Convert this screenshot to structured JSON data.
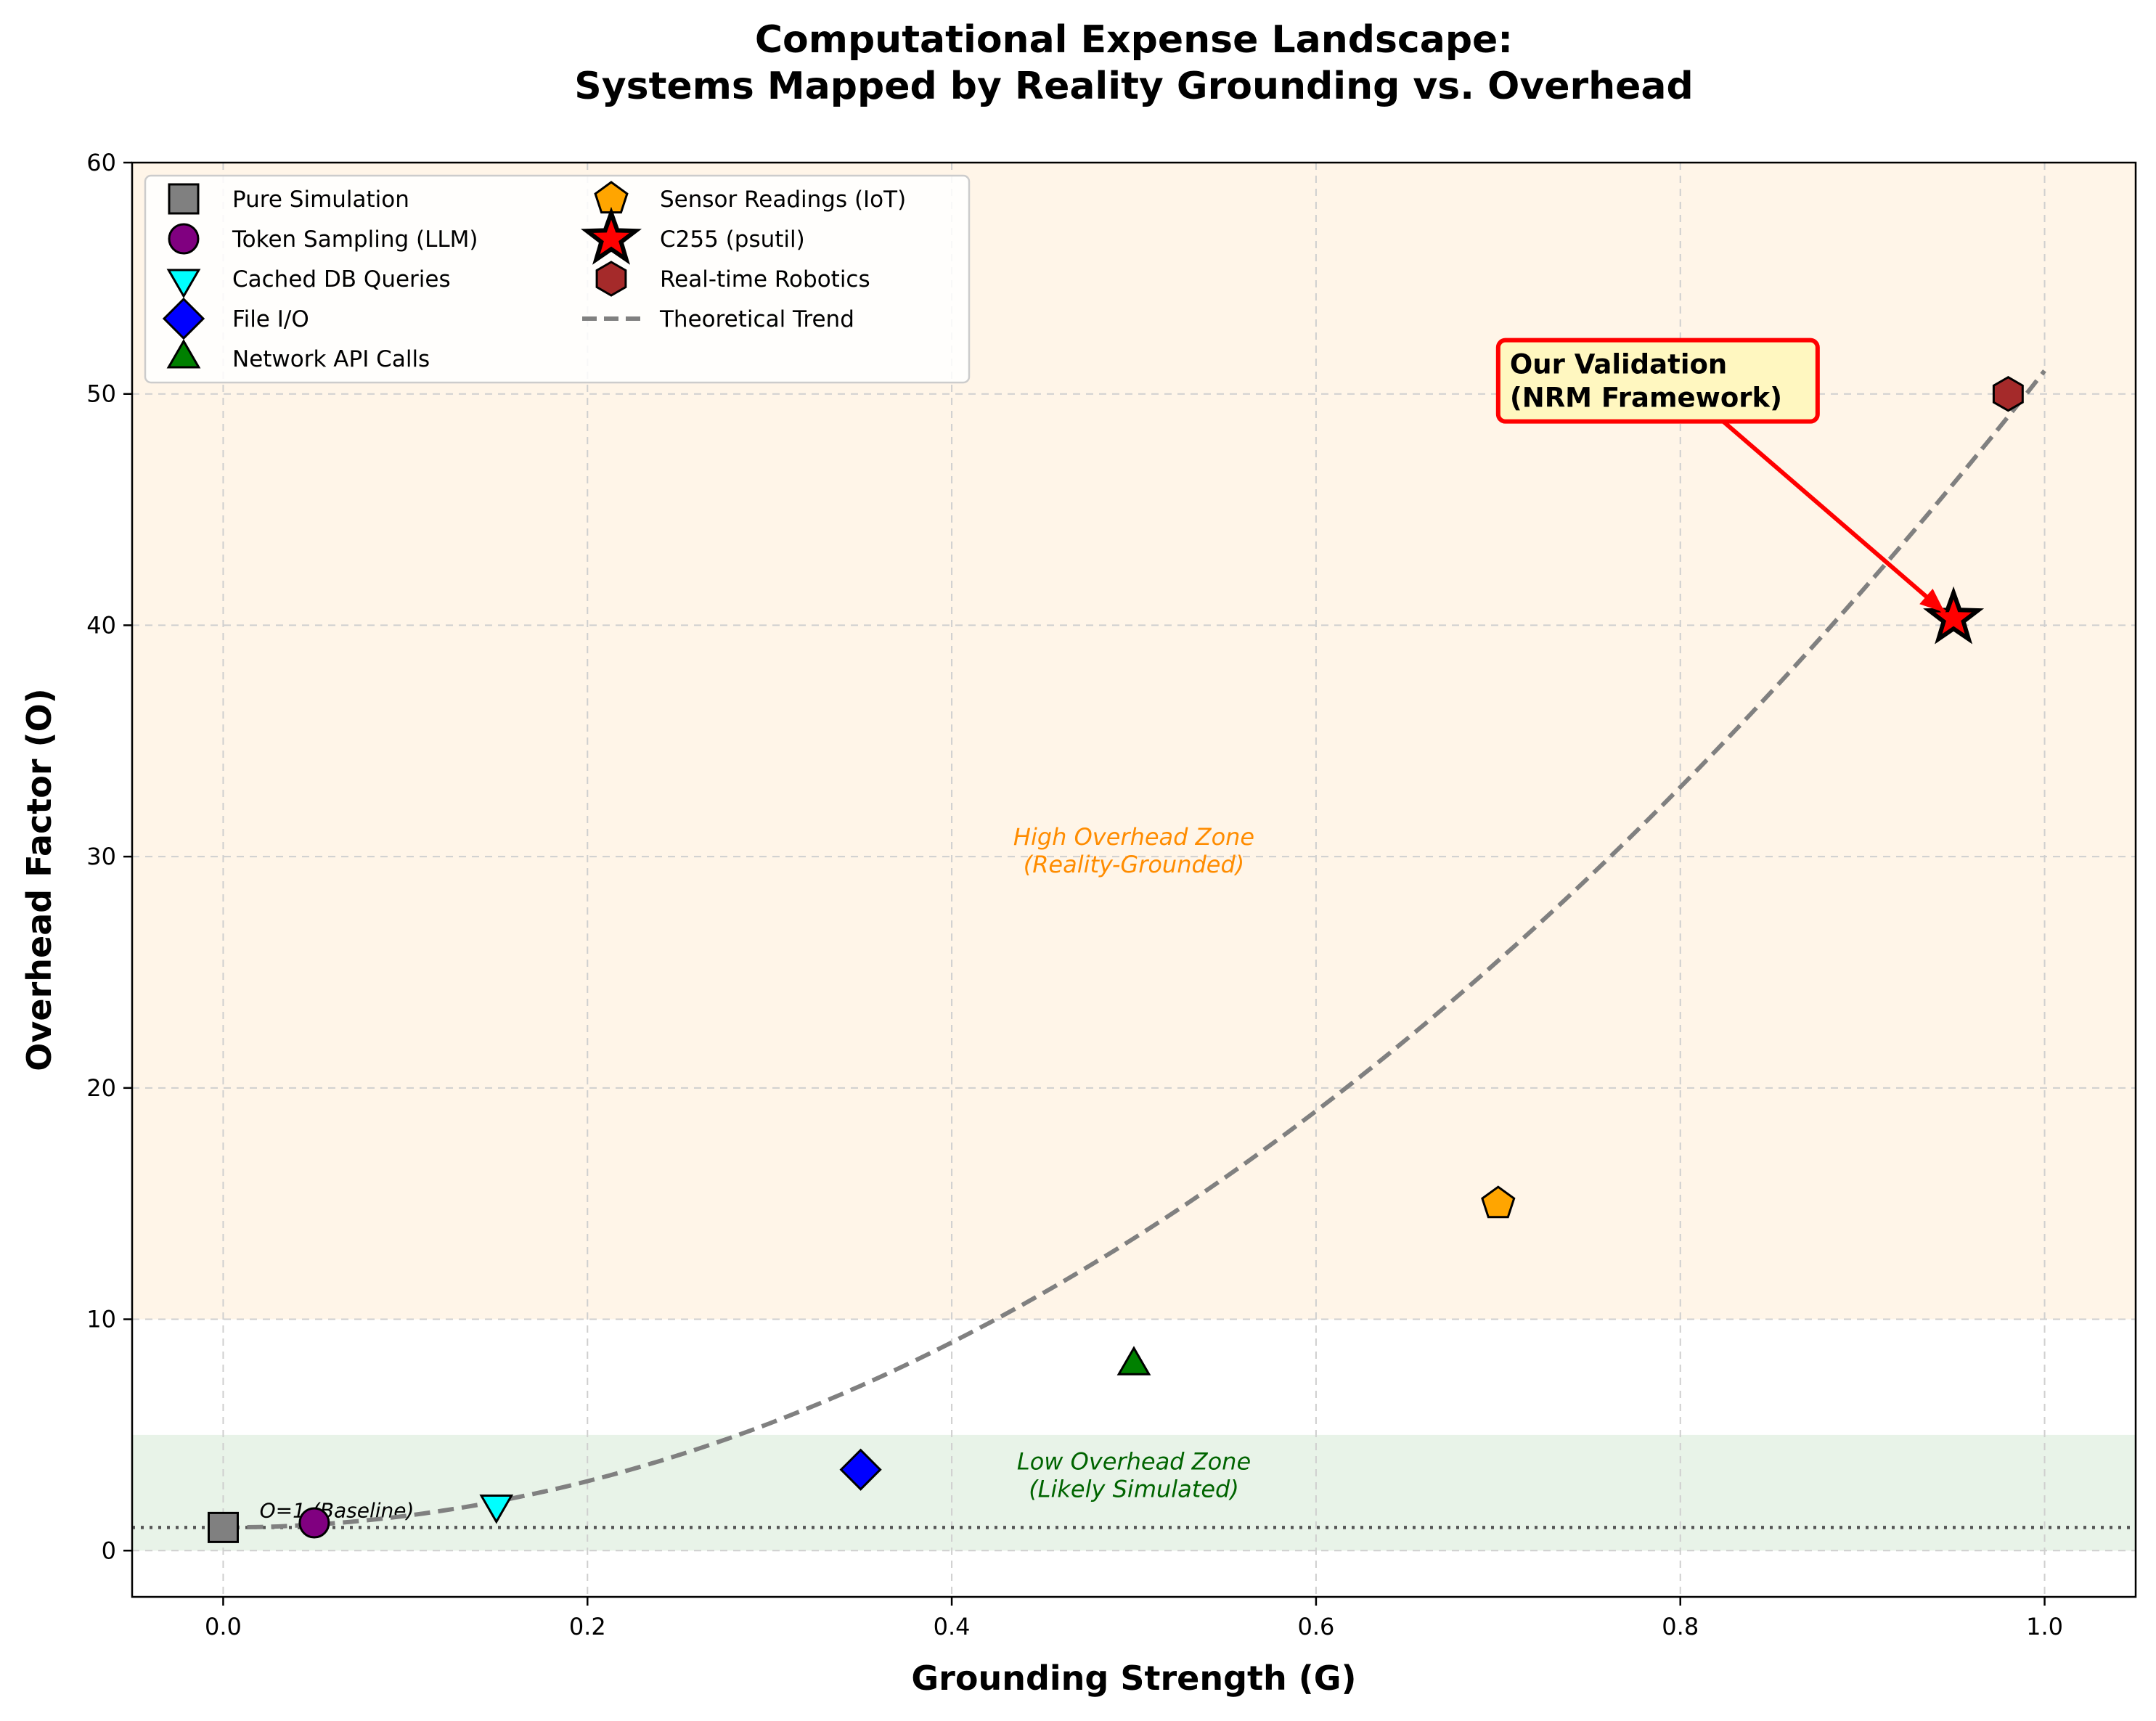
{
  "chart_data": {
    "type": "scatter",
    "title": [
      "Computational Expense Landscape:",
      "Systems Mapped by Reality Grounding vs. Overhead"
    ],
    "xlabel": "Grounding Strength (G)",
    "ylabel": "Overhead Factor (O)",
    "xlim": [
      -0.05,
      1.05
    ],
    "ylim": [
      -2,
      60
    ],
    "xticks": [
      "0.0",
      "0.2",
      "0.4",
      "0.6",
      "0.8",
      "1.0"
    ],
    "yticks": [
      "0",
      "10",
      "20",
      "30",
      "40",
      "50",
      "60"
    ],
    "grid": true,
    "legend_placement": "top-left",
    "series": [
      {
        "name": "Pure Simulation",
        "x": 0.0,
        "y": 1.0,
        "marker": "square",
        "color": "#808080"
      },
      {
        "name": "Token Sampling (LLM)",
        "x": 0.05,
        "y": 1.2,
        "marker": "circle",
        "color": "#800080"
      },
      {
        "name": "Cached DB Queries",
        "x": 0.15,
        "y": 2.0,
        "marker": "triangle-down",
        "color": "#00ffff"
      },
      {
        "name": "File I/O",
        "x": 0.35,
        "y": 3.5,
        "marker": "diamond",
        "color": "#0000ff"
      },
      {
        "name": "Network API Calls",
        "x": 0.5,
        "y": 8.0,
        "marker": "triangle-up",
        "color": "#008000"
      },
      {
        "name": "Sensor Readings (IoT)",
        "x": 0.7,
        "y": 15.0,
        "marker": "pentagon",
        "color": "#ffa500"
      },
      {
        "name": "C255 (psutil)",
        "x": 0.95,
        "y": 40.3,
        "marker": "star",
        "color": "#ff0000"
      },
      {
        "name": "Real-time Robotics",
        "x": 0.98,
        "y": 50.0,
        "marker": "hexagon",
        "color": "#a52a2a"
      }
    ],
    "trend": {
      "name": "Theoretical Trend",
      "formula": "O = 1 + 50*G^2",
      "style": "dashed",
      "color": "#808080"
    },
    "baseline": {
      "value": 1,
      "label": "O=1 (Baseline)",
      "style": "dotted"
    },
    "zones": [
      {
        "label": [
          "High Overhead Zone",
          "(Reality-Grounded)"
        ],
        "ymin": 10,
        "ymax": 60,
        "color": "#fff5e8",
        "text_color": "#ff8c00",
        "label_x": 0.5,
        "label_y": 30.5
      },
      {
        "label": [
          "Low Overhead Zone",
          "(Likely Simulated)"
        ],
        "ymin": 0,
        "ymax": 5,
        "color": "#e8f3e8",
        "text_color": "#006400",
        "label_x": 0.5,
        "label_y": 3.5
      }
    ],
    "annotation": {
      "text": [
        "Our Validation",
        "(NRM Framework)"
      ],
      "target": "C255 (psutil)",
      "target_x": 0.95,
      "target_y": 40.3,
      "text_x": 0.7,
      "text_y": 49.5,
      "color": "#ff0000",
      "box_fill": "#fff7c0"
    }
  }
}
